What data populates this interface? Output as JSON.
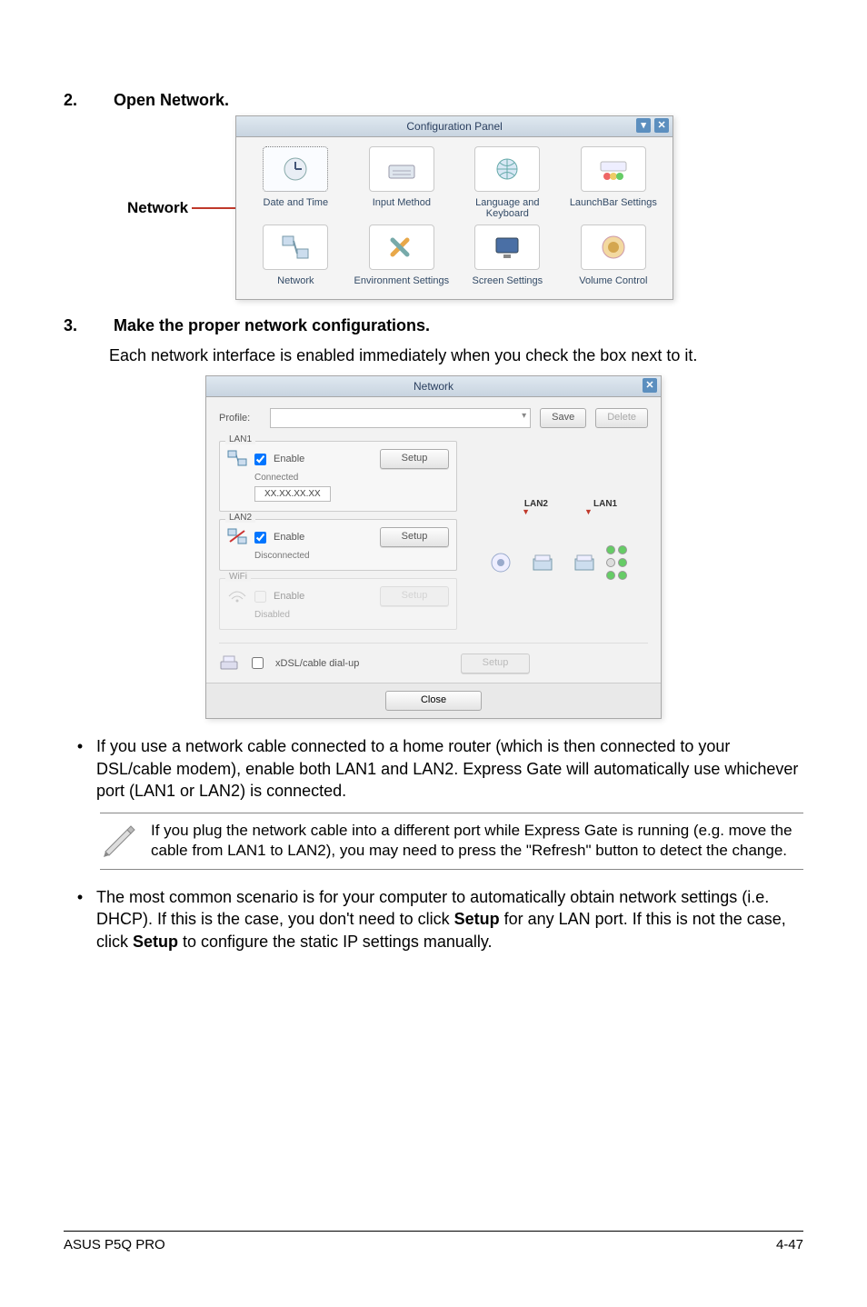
{
  "step2": {
    "num": "2.",
    "title": "Open Network."
  },
  "step3": {
    "num": "3.",
    "title": "Make the proper network configurations."
  },
  "step3_body": "Each network interface is enabled immediately when you check the box next to it.",
  "network_label": "Network",
  "config_panel": {
    "title": "Configuration Panel",
    "items": [
      "Date and Time",
      "Input Method",
      "Language and Keyboard",
      "LaunchBar Settings",
      "Network",
      "Environment Settings",
      "Screen Settings",
      "Volume Control"
    ]
  },
  "network_dialog": {
    "title": "Network",
    "profile_label": "Profile:",
    "save": "Save",
    "delete": "Delete",
    "lan1": {
      "title": "LAN1",
      "enable": "Enable",
      "setup": "Setup",
      "status": "Connected",
      "ip": "XX.XX.XX.XX"
    },
    "lan2": {
      "title": "LAN2",
      "enable": "Enable",
      "setup": "Setup",
      "status": "Disconnected"
    },
    "wifi": {
      "title": "WiFi",
      "enable": "Enable",
      "setup": "Setup",
      "status": "Disabled"
    },
    "xdsl": {
      "label": "xDSL/cable dial-up",
      "setup": "Setup"
    },
    "close": "Close",
    "diagram": {
      "lan2_label": "LAN2",
      "lan1_label": "LAN1"
    }
  },
  "bullet1": "If you use a network cable connected to a home router (which is then connected to your DSL/cable modem), enable both LAN1 and LAN2. Express Gate  will automatically use whichever port (LAN1 or LAN2) is connected.",
  "note": "If you plug the network cable into a different port while Express Gate  is running (e.g. move the cable from LAN1 to LAN2), you may need to press the \"Refresh\" button to detect the change.",
  "bullet2_pre": "The most common scenario is for your computer to automatically obtain network settings (i.e. DHCP). If this is the case, you don't need to click ",
  "bullet2_setup1": "Setup",
  "bullet2_mid": " for any LAN port. If this is not the case, click ",
  "bullet2_setup2": "Setup",
  "bullet2_post": " to configure the static IP settings manually.",
  "footer": {
    "left": "ASUS P5Q PRO",
    "right": "4-47"
  }
}
